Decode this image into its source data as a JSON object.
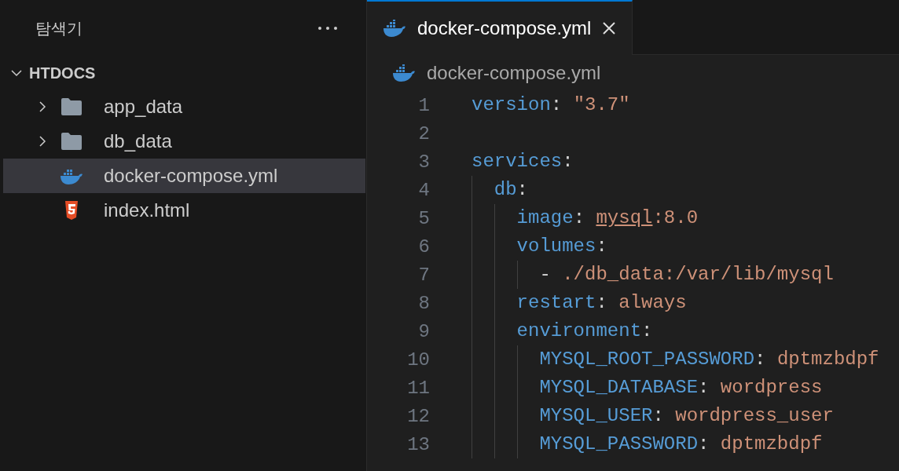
{
  "sidebar": {
    "title": "탐색기",
    "workspace": {
      "name": "HTDOCS",
      "expanded": true
    },
    "items": [
      {
        "name": "app_data",
        "kind": "folder",
        "expanded": false,
        "selected": false
      },
      {
        "name": "db_data",
        "kind": "folder",
        "expanded": false,
        "selected": false
      },
      {
        "name": "docker-compose.yml",
        "kind": "docker",
        "selected": true
      },
      {
        "name": "index.html",
        "kind": "html",
        "selected": false
      }
    ]
  },
  "tabs": [
    {
      "label": "docker-compose.yml",
      "kind": "docker",
      "selected": true
    }
  ],
  "breadcrumb": {
    "label": "docker-compose.yml",
    "kind": "docker"
  },
  "code": [
    {
      "number": "1",
      "tokens": [
        {
          "kind": "key",
          "text": "version"
        },
        {
          "kind": "punct",
          "text": ": "
        },
        {
          "kind": "string",
          "text": "\"3.7\""
        }
      ]
    },
    {
      "number": "2"
    },
    {
      "number": "3",
      "tokens": [
        {
          "kind": "key",
          "text": "services"
        },
        {
          "kind": "punct",
          "text": ":"
        }
      ]
    },
    {
      "number": "4",
      "tokens": [
        {
          "kind": "key",
          "text": "  db"
        },
        {
          "kind": "punct",
          "text": ":"
        }
      ]
    },
    {
      "number": "5",
      "tokens": [
        {
          "kind": "key",
          "text": "    image"
        },
        {
          "kind": "punct",
          "text": ": "
        },
        {
          "kind": "link",
          "text": "mysql"
        },
        {
          "kind": "string",
          "text": ":8.0"
        }
      ]
    },
    {
      "number": "6",
      "tokens": [
        {
          "kind": "key",
          "text": "    volumes"
        },
        {
          "kind": "punct",
          "text": ":"
        }
      ]
    },
    {
      "number": "7",
      "tokens": [
        {
          "kind": "punct",
          "text": "      - "
        },
        {
          "kind": "string",
          "text": "./db_data:/var/lib/mysql"
        }
      ]
    },
    {
      "number": "8",
      "tokens": [
        {
          "kind": "key",
          "text": "    restart"
        },
        {
          "kind": "punct",
          "text": ": "
        },
        {
          "kind": "string",
          "text": "always"
        }
      ]
    },
    {
      "number": "9",
      "tokens": [
        {
          "kind": "key",
          "text": "    environment"
        },
        {
          "kind": "punct",
          "text": ":"
        }
      ]
    },
    {
      "number": "10",
      "tokens": [
        {
          "kind": "key",
          "text": "      MYSQL_ROOT_PASSWORD"
        },
        {
          "kind": "punct",
          "text": ": "
        },
        {
          "kind": "string",
          "text": "dptmzbdpf"
        }
      ]
    },
    {
      "number": "11",
      "tokens": [
        {
          "kind": "key",
          "text": "      MYSQL_DATABASE"
        },
        {
          "kind": "punct",
          "text": ": "
        },
        {
          "kind": "string",
          "text": "wordpress"
        }
      ]
    },
    {
      "number": "12",
      "tokens": [
        {
          "kind": "key",
          "text": "      MYSQL_USER"
        },
        {
          "kind": "punct",
          "text": ": "
        },
        {
          "kind": "string",
          "text": "wordpress_user"
        }
      ]
    },
    {
      "number": "13",
      "tokens": [
        {
          "kind": "key",
          "text": "      MYSQL_PASSWORD"
        },
        {
          "kind": "punct",
          "text": ": "
        },
        {
          "kind": "string",
          "text": "dptmzbdpf"
        }
      ]
    }
  ]
}
